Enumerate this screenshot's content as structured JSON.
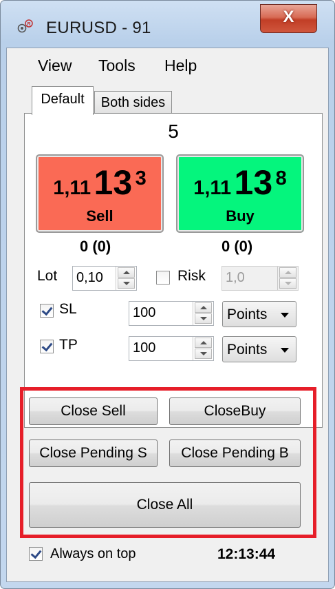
{
  "window": {
    "title": "EURUSD - 91",
    "close_glyph": "X"
  },
  "menu": {
    "items": [
      "View",
      "Tools",
      "Help"
    ]
  },
  "tabs": {
    "items": [
      "Default",
      "Both sides"
    ],
    "active": "Default"
  },
  "spread": "5",
  "sell": {
    "price_big": "1,11",
    "price_pips": "13",
    "price_fraction": "3",
    "label": "Sell",
    "count": "0 (0)",
    "color": "#fa6a55"
  },
  "buy": {
    "price_big": "1,11",
    "price_pips": "13",
    "price_fraction": "8",
    "label": "Buy",
    "count": "0 (0)",
    "color": "#05f57d"
  },
  "lot": {
    "label": "Lot",
    "value": "0,10"
  },
  "risk": {
    "label": "Risk",
    "checked": false,
    "value": "1,0",
    "enabled": false
  },
  "sl": {
    "label": "SL",
    "checked": true,
    "value": "100",
    "unit": "Points"
  },
  "tp": {
    "label": "TP",
    "checked": true,
    "value": "100",
    "unit": "Points"
  },
  "actions": {
    "close_sell": "Close Sell",
    "close_buy": "CloseBuy",
    "close_pending_s": "Close Pending S",
    "close_pending_b": "Close  Pending B",
    "close_all": "Close All",
    "highlight_color": "#e61e29"
  },
  "footer": {
    "always_on_top_label": "Always on top",
    "always_on_top_checked": true,
    "clock": "12:13:44"
  },
  "icons": [
    "app-icon",
    "close-icon",
    "spin-up-icon",
    "spin-down-icon",
    "dropdown-arrow-icon",
    "checkbox-check-icon"
  ]
}
